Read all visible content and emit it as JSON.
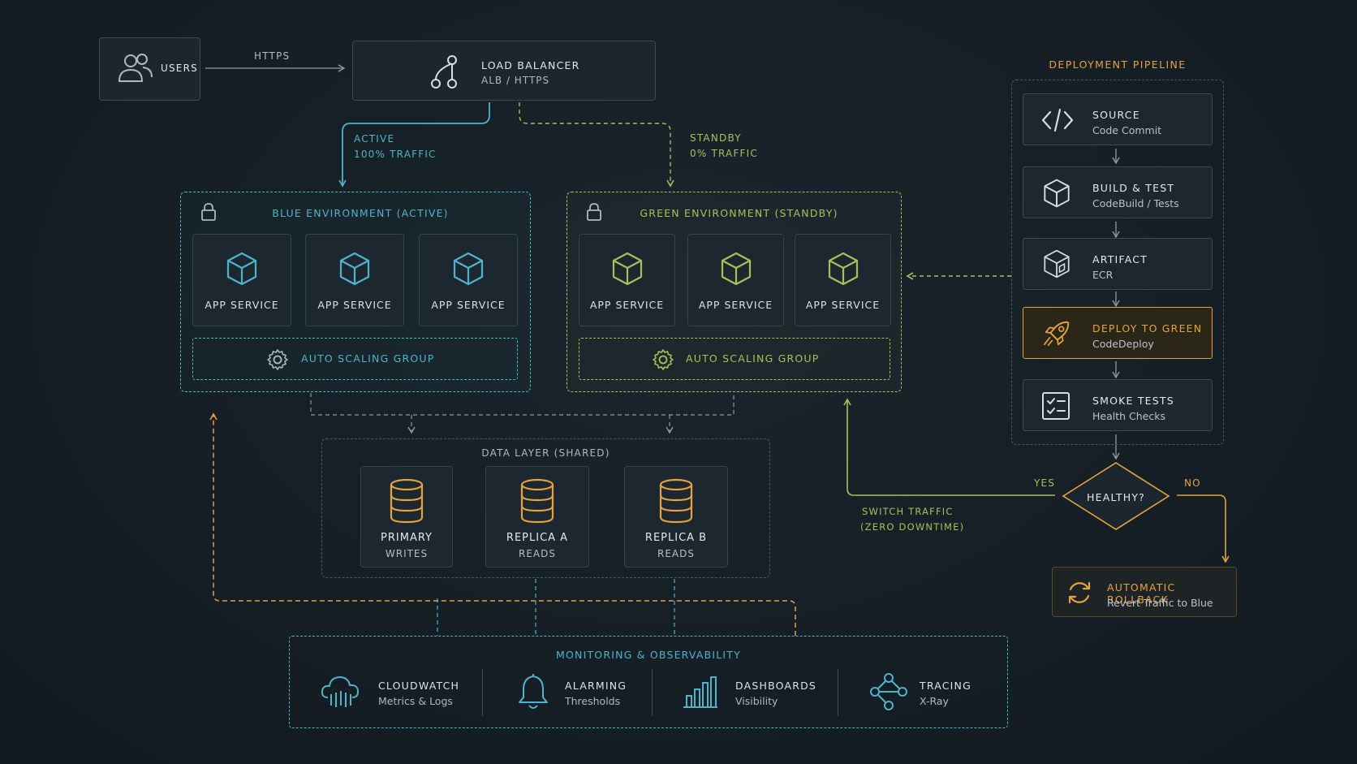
{
  "colors": {
    "blue": "#4fb3c9",
    "green": "#a6c15a",
    "orange": "#e5a23f",
    "neutral": "#8d9aa3",
    "background": "#162027"
  },
  "users": {
    "label": "USERS",
    "icon": "users-icon"
  },
  "https_label": "HTTPS",
  "load_balancer": {
    "title": "LOAD BALANCER",
    "subtitle": "ALB / HTTPS",
    "icon": "branch-icon"
  },
  "active_traffic": {
    "line1": "ACTIVE",
    "line2": "100% TRAFFIC"
  },
  "standby_traffic": {
    "line1": "STANDBY",
    "line2": "0% TRAFFIC"
  },
  "blue_env": {
    "title": "BLUE ENVIRONMENT (ACTIVE)",
    "services": [
      "APP SERVICE",
      "APP SERVICE",
      "APP SERVICE"
    ],
    "asg": "AUTO SCALING GROUP"
  },
  "green_env": {
    "title": "GREEN ENVIRONMENT (STANDBY)",
    "services": [
      "APP SERVICE",
      "APP SERVICE",
      "APP SERVICE"
    ],
    "asg": "AUTO SCALING GROUP"
  },
  "data_layer": {
    "title": "DATA LAYER (SHARED)",
    "dbs": [
      {
        "name": "PRIMARY",
        "role": "WRITES"
      },
      {
        "name": "REPLICA A",
        "role": "READS"
      },
      {
        "name": "REPLICA B",
        "role": "READS"
      }
    ]
  },
  "pipeline": {
    "title": "DEPLOYMENT PIPELINE",
    "steps": [
      {
        "title": "SOURCE",
        "subtitle": "Code Commit",
        "icon": "code-icon"
      },
      {
        "title": "BUILD & TEST",
        "subtitle": "CodeBuild / Tests",
        "icon": "cube-icon"
      },
      {
        "title": "ARTIFACT",
        "subtitle": "ECR",
        "icon": "package-icon"
      },
      {
        "title": "DEPLOY TO GREEN",
        "subtitle": "CodeDeploy",
        "icon": "rocket-icon"
      },
      {
        "title": "SMOKE TESTS",
        "subtitle": "Health Checks",
        "icon": "checklist-icon"
      }
    ]
  },
  "decision": {
    "label": "HEALTHY?",
    "yes": "YES",
    "no": "NO"
  },
  "switch_traffic": {
    "line1": "SWITCH TRAFFIC",
    "line2": "(ZERO DOWNTIME)"
  },
  "rollback": {
    "title": "AUTOMATIC ROLLBACK",
    "subtitle": "Revert Traffic to Blue",
    "icon": "refresh-icon"
  },
  "monitoring": {
    "title": "MONITORING & OBSERVABILITY",
    "items": [
      {
        "title": "CLOUDWATCH",
        "subtitle": "Metrics & Logs",
        "icon": "cloud-icon"
      },
      {
        "title": "ALARMING",
        "subtitle": "Thresholds",
        "icon": "bell-icon"
      },
      {
        "title": "DASHBOARDS",
        "subtitle": "Visibility",
        "icon": "bar-chart-icon"
      },
      {
        "title": "TRACING",
        "subtitle": "X-Ray",
        "icon": "trace-icon"
      }
    ]
  }
}
